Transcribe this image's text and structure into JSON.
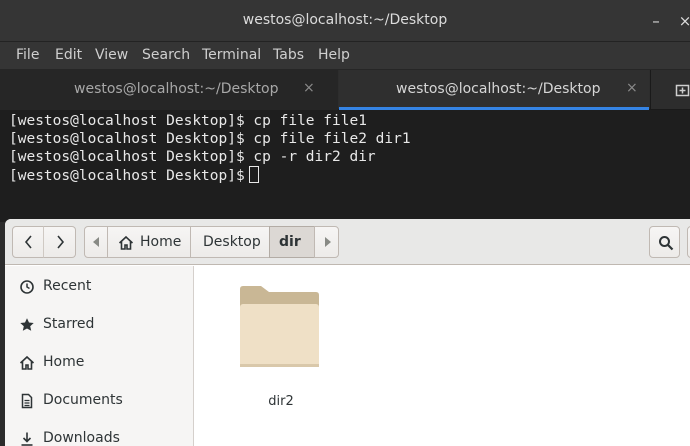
{
  "terminal": {
    "title": "westos@localhost:~/Desktop",
    "menu": [
      "File",
      "Edit",
      "View",
      "Search",
      "Terminal",
      "Tabs",
      "Help"
    ],
    "tabs": [
      {
        "label": "westos@localhost:~/Desktop",
        "active": false
      },
      {
        "label": "westos@localhost:~/Desktop",
        "active": true
      }
    ],
    "close_glyph": "×",
    "minimize_glyph": "–",
    "lines": [
      "[westos@localhost Desktop]$ cp file file1",
      "[westos@localhost Desktop]$ cp file file2 dir1",
      "[westos@localhost Desktop]$ cp -r dir2 dir",
      "[westos@localhost Desktop]$"
    ]
  },
  "files": {
    "breadcrumbs": [
      "Home",
      "Desktop",
      "dir"
    ],
    "sidebar": [
      {
        "label": "Recent",
        "icon": "clock-icon"
      },
      {
        "label": "Starred",
        "icon": "star-icon"
      },
      {
        "label": "Home",
        "icon": "home-icon"
      },
      {
        "label": "Documents",
        "icon": "document-icon"
      },
      {
        "label": "Downloads",
        "icon": "download-icon"
      }
    ],
    "items": [
      {
        "name": "dir2",
        "icon": "folder-icon"
      }
    ]
  },
  "colors": {
    "accent": "#3584e4",
    "folder_front": "#efe0c6",
    "folder_back": "#c9b795"
  }
}
